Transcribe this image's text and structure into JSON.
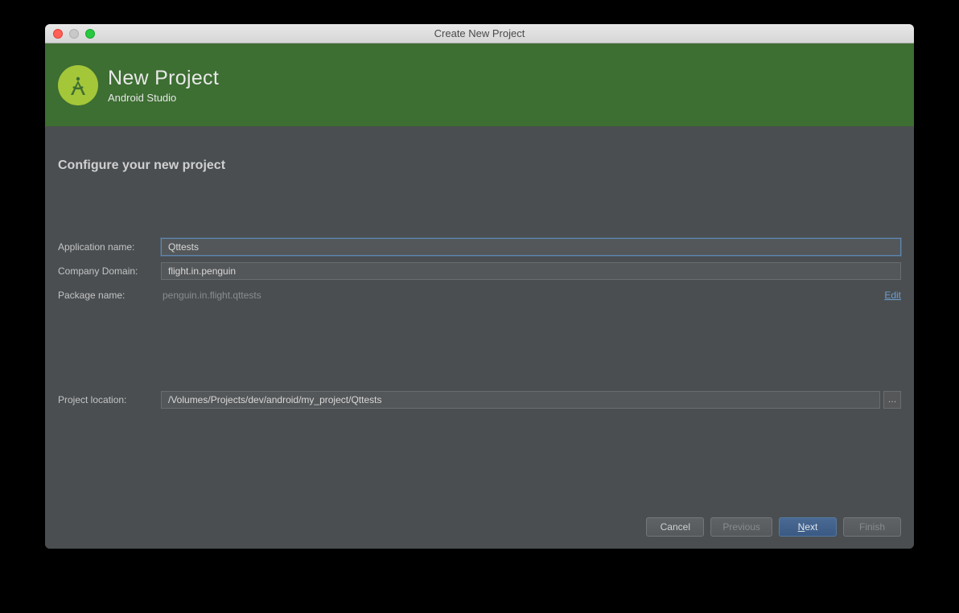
{
  "window": {
    "title": "Create New Project"
  },
  "header": {
    "title": "New Project",
    "subtitle": "Android Studio"
  },
  "section": {
    "title": "Configure your new project"
  },
  "form": {
    "app_name_label": "Application name:",
    "app_name_value": "Qttests",
    "company_domain_label": "Company Domain:",
    "company_domain_value": "flight.in.penguin",
    "package_name_label": "Package name:",
    "package_name_value": "penguin.in.flight.qttests",
    "edit_link": "Edit",
    "project_location_label": "Project location:",
    "project_location_value": "/Volumes/Projects/dev/android/my_project/Qttests",
    "browse_label": "…"
  },
  "buttons": {
    "cancel": "Cancel",
    "previous": "Previous",
    "next_mnemonic": "N",
    "next_rest": "ext",
    "finish": "Finish"
  }
}
